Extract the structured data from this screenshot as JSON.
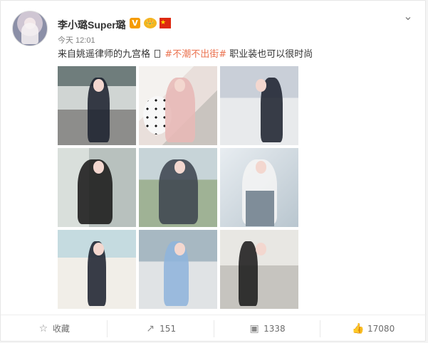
{
  "post": {
    "author": "李小璐Super璐",
    "timestamp": "今天 12:01",
    "text_before": "来自姚遥律师的九宫格",
    "topic": "#不潮不出街#",
    "text_after": "职业装也可以很时尚"
  },
  "badges": {
    "verified": "V",
    "crown": "👑",
    "flag": "★"
  },
  "icons": {
    "menu": "chevron-down-icon",
    "favorite": "star-icon",
    "share": "share-icon",
    "comment": "comment-icon",
    "like": "thumb-up-icon"
  },
  "gallery": {
    "photos": [
      "photo-1",
      "photo-2",
      "photo-3",
      "photo-4",
      "photo-5",
      "photo-6",
      "photo-7",
      "photo-8",
      "photo-9"
    ]
  },
  "actions": {
    "favorite_label": "收藏",
    "share_count": "151",
    "comment_count": "1338",
    "like_count": "17080"
  },
  "colors": {
    "topic": "#eb7350",
    "verified": "#f59b00",
    "text": "#333333",
    "muted": "#808080"
  }
}
